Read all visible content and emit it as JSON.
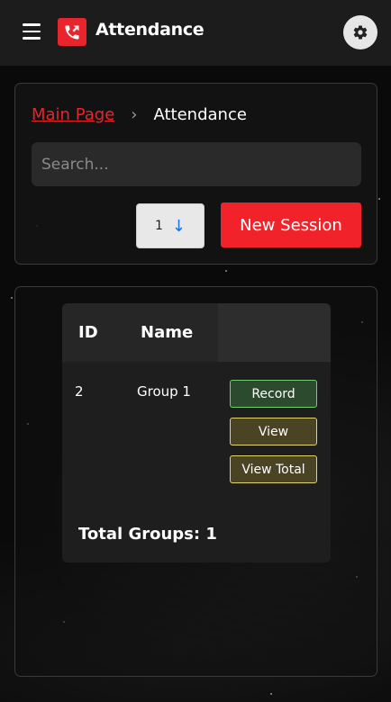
{
  "header": {
    "title": "Attendance",
    "accent_color": "#e8242c",
    "menu_icon": "hamburger-menu-icon",
    "logo_icon": "phone-icon",
    "settings_icon": "gear-icon"
  },
  "breadcrumb": {
    "parent_label": "Main Page",
    "current_label": "Attendance",
    "separator": "›"
  },
  "search": {
    "placeholder": "Search...",
    "value": ""
  },
  "controls": {
    "sort_value": "1",
    "sort_direction_icon": "↓",
    "new_session_label": "New Session"
  },
  "table": {
    "columns": [
      "ID",
      "Name",
      ""
    ],
    "rows": [
      {
        "id": "2",
        "name": "Group 1",
        "actions": [
          "Record",
          "View",
          "View Total"
        ]
      }
    ],
    "total_label": "Total Groups: 1"
  }
}
